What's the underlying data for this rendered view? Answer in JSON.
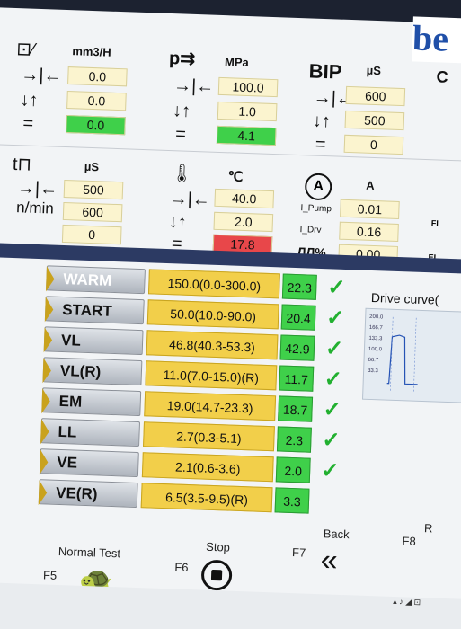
{
  "brand": "be",
  "params": {
    "flow": {
      "unit": "mm3/H",
      "v1": "0.0",
      "v2": "0.0",
      "v3": "0.0"
    },
    "pressure": {
      "unit": "MPa",
      "v1": "100.0",
      "v2": "1.0",
      "v3": "4.1"
    },
    "bip": {
      "label": "BIP",
      "unit": "µS",
      "v1": "600",
      "v2": "500",
      "v3": "0"
    },
    "c": {
      "label": "C"
    },
    "time": {
      "unit": "µS",
      "per_min": "/min",
      "v1": "500",
      "v2": "600",
      "v3": "0"
    },
    "temp": {
      "unit": "℃",
      "v1": "40.0",
      "v2": "2.0",
      "v3": "17.8"
    },
    "current": {
      "unit": "A",
      "pump": "I_Pump",
      "drv": "I_Drv",
      "pct": "%",
      "v1": "0.01",
      "v2": "0.16",
      "v3": "0.00"
    },
    "fi": {
      "label": "FI",
      "ei": "EI"
    }
  },
  "tests": [
    {
      "label": "WARM",
      "range": "150.0(0.0-300.0)",
      "measured": "22.3"
    },
    {
      "label": "START",
      "range": "50.0(10.0-90.0)",
      "measured": "20.4"
    },
    {
      "label": "VL",
      "range": "46.8(40.3-53.3)",
      "measured": "42.9"
    },
    {
      "label": "VL(R)",
      "range": "11.0(7.0-15.0)(R)",
      "measured": "11.7"
    },
    {
      "label": "EM",
      "range": "19.0(14.7-23.3)",
      "measured": "18.7"
    },
    {
      "label": "LL",
      "range": "2.7(0.3-5.1)",
      "measured": "2.3"
    },
    {
      "label": "VE",
      "range": "2.1(0.6-3.6)",
      "measured": "2.0"
    },
    {
      "label": "VE(R)",
      "range": "6.5(3.5-9.5)(R)",
      "measured": "3.3"
    }
  ],
  "drive_curve": {
    "title": "Drive curve(",
    "yticks": [
      "200.0",
      "166.7",
      "133.3",
      "100.0",
      "66.7",
      "33.3"
    ]
  },
  "footer": {
    "st": "st",
    "normal_test": "Normal Test",
    "f5": "F5",
    "stop": "Stop",
    "f6": "F6",
    "f7": "F7",
    "back": "Back",
    "f8": "F8",
    "r": "R"
  },
  "colors": {
    "green": "#3fd04a",
    "red": "#e8474a",
    "yellow": "#f2cf4a",
    "navy": "#2c3a63"
  }
}
